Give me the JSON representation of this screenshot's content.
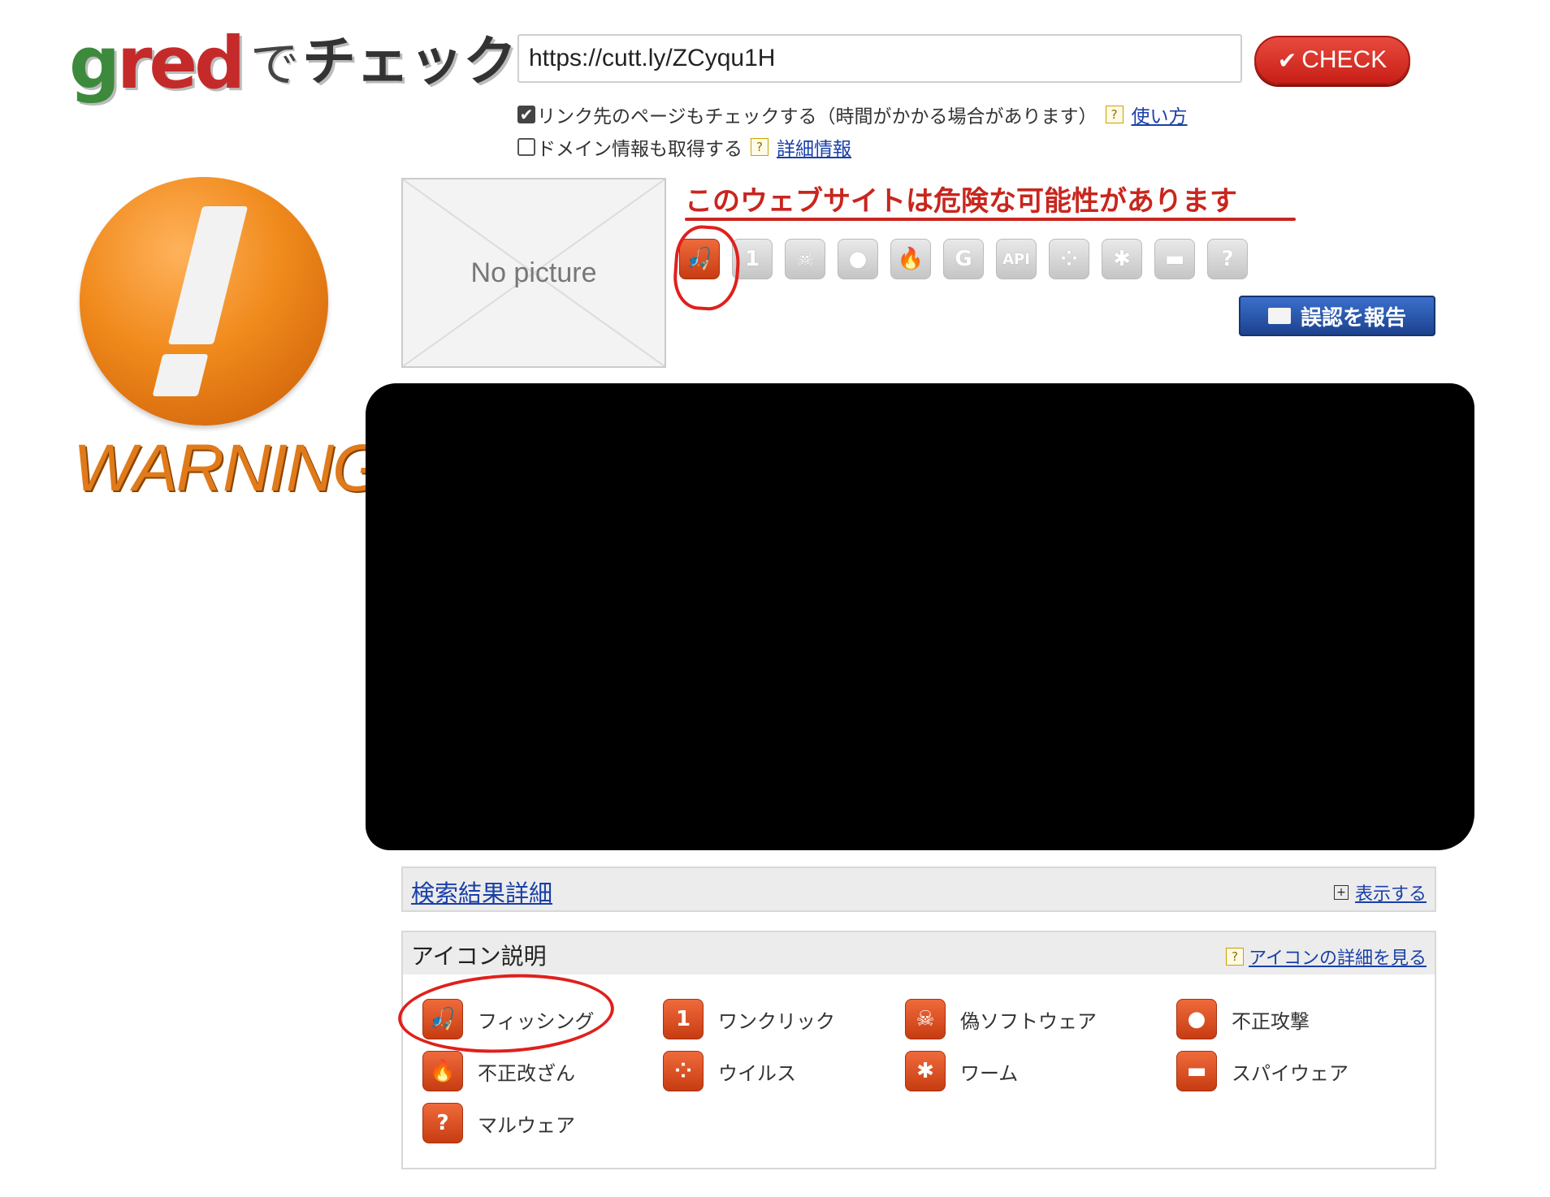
{
  "logo": {
    "text_g": "g",
    "text_red": "red",
    "text_de": "で",
    "text_check": "チェック"
  },
  "search": {
    "url_value": "https://cutt.ly/ZCyqu1H",
    "check_label": "CHECK"
  },
  "options": {
    "link_check_label": "リンク先のページもチェックする（時間がかかる場合があります）",
    "link_check_checked": true,
    "usage_link": "使い方",
    "domain_info_label": "ドメイン情報も取得する",
    "domain_info_checked": false,
    "details_link": "詳細情報"
  },
  "warning": {
    "label": "WARNING!"
  },
  "preview": {
    "no_picture": "No picture"
  },
  "result": {
    "headline": "このウェブサイトは危険な可能性があります"
  },
  "threat_icons": [
    {
      "name": "phishing",
      "glyph": "🎣",
      "active": true
    },
    {
      "name": "one-click",
      "glyph": "1",
      "active": false
    },
    {
      "name": "fake-software",
      "glyph": "☠",
      "active": false
    },
    {
      "name": "attack",
      "glyph": "●",
      "active": false
    },
    {
      "name": "tampering",
      "glyph": "🔥",
      "active": false
    },
    {
      "name": "g",
      "glyph": "G",
      "active": false
    },
    {
      "name": "api",
      "glyph": "API",
      "active": false
    },
    {
      "name": "virus",
      "glyph": "⁘",
      "active": false
    },
    {
      "name": "worm",
      "glyph": "✱",
      "active": false
    },
    {
      "name": "spyware",
      "glyph": "▬",
      "active": false
    },
    {
      "name": "malware",
      "glyph": "?",
      "active": false
    }
  ],
  "report_button": "誤認を報告",
  "search_details": {
    "title": "検索結果詳細",
    "toggle": "表示する"
  },
  "legend": {
    "title": "アイコン説明",
    "details_link": "アイコンの詳細を見る",
    "items": [
      {
        "label": "フィッシング",
        "glyph": "🎣"
      },
      {
        "label": "ワンクリック",
        "glyph": "1"
      },
      {
        "label": "偽ソフトウェア",
        "glyph": "☠"
      },
      {
        "label": "不正攻撃",
        "glyph": "●"
      },
      {
        "label": "不正改ざん",
        "glyph": "🔥"
      },
      {
        "label": "ウイルス",
        "glyph": "⁘"
      },
      {
        "label": "ワーム",
        "glyph": "✱"
      },
      {
        "label": "スパイウェア",
        "glyph": "▬"
      },
      {
        "label": "マルウェア",
        "glyph": "?"
      }
    ]
  },
  "colors": {
    "danger_red": "#c8261e",
    "link_blue": "#1a3fa8",
    "report_blue": "#2a58b0",
    "active_icon": "#e0552a"
  }
}
